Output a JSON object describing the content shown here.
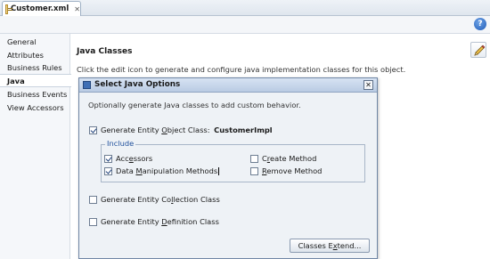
{
  "tabs": [
    {
      "label": "Customer.xml",
      "icon": "xml-file-icon",
      "close": "✕"
    }
  ],
  "toolbar": {
    "help_label": "?"
  },
  "sidenav": {
    "items": [
      {
        "label": "General"
      },
      {
        "label": "Attributes"
      },
      {
        "label": "Business Rules"
      },
      {
        "label": "Java",
        "active": true
      },
      {
        "label": "Business Events"
      },
      {
        "label": "View Accessors"
      }
    ]
  },
  "content": {
    "title": "Java Classes",
    "description": "Click the edit icon to generate and configure java implementation classes for this object."
  },
  "dialog": {
    "title": "Select Java Options",
    "close": "✕",
    "description": "Optionally generate Java classes to add custom behavior.",
    "gen_object_class": {
      "pre": "Generate Entity ",
      "u": "O",
      "post": "bject Class: ",
      "class_name": "CustomerImpl",
      "checked": true
    },
    "include": {
      "label": "Include",
      "accessors": {
        "pre": "Acc",
        "u": "e",
        "post": "ssors",
        "checked": true
      },
      "dml_methods": {
        "pre": "Data ",
        "u": "M",
        "post": "anipulation Methods",
        "checked": true
      },
      "create_method": {
        "pre": "C",
        "u": "r",
        "post": "eate Method",
        "checked": false
      },
      "remove_method": {
        "pre": "",
        "u": "R",
        "post": "emove Method",
        "checked": false
      }
    },
    "gen_collection_class": {
      "pre": "Generate Entity Co",
      "u": "l",
      "post": "lection Class",
      "checked": false
    },
    "gen_definition_class": {
      "pre": "Generate Entity ",
      "u": "D",
      "post": "efinition Class",
      "checked": false
    },
    "extend_button": {
      "pre": "Classes E",
      "u": "x",
      "post": "tend..."
    }
  }
}
